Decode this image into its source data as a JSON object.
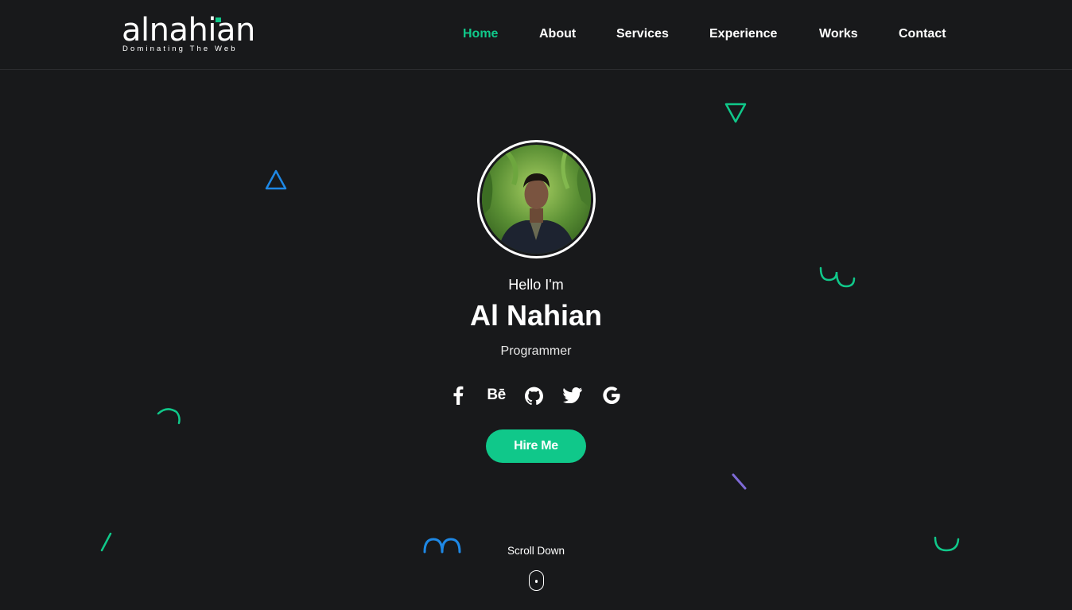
{
  "brand": {
    "name": "alnahian",
    "tagline": "Dominating The Web",
    "accent_color": "#10c88a"
  },
  "nav": {
    "items": [
      {
        "label": "Home",
        "active": true
      },
      {
        "label": "About",
        "active": false
      },
      {
        "label": "Services",
        "active": false
      },
      {
        "label": "Experience",
        "active": false
      },
      {
        "label": "Works",
        "active": false
      },
      {
        "label": "Contact",
        "active": false
      }
    ]
  },
  "hero": {
    "greeting": "Hello I'm",
    "name": "Al Nahian",
    "role": "Programmer",
    "socials": [
      {
        "name": "facebook-icon"
      },
      {
        "name": "behance-icon",
        "label": "Bē"
      },
      {
        "name": "github-icon"
      },
      {
        "name": "twitter-icon"
      },
      {
        "name": "google-icon"
      }
    ],
    "hire_button": "Hire Me",
    "scroll_label": "Scroll Down"
  },
  "decor_colors": {
    "green": "#10c88a",
    "blue": "#1e88e5",
    "purple": "#7e6ad6"
  }
}
